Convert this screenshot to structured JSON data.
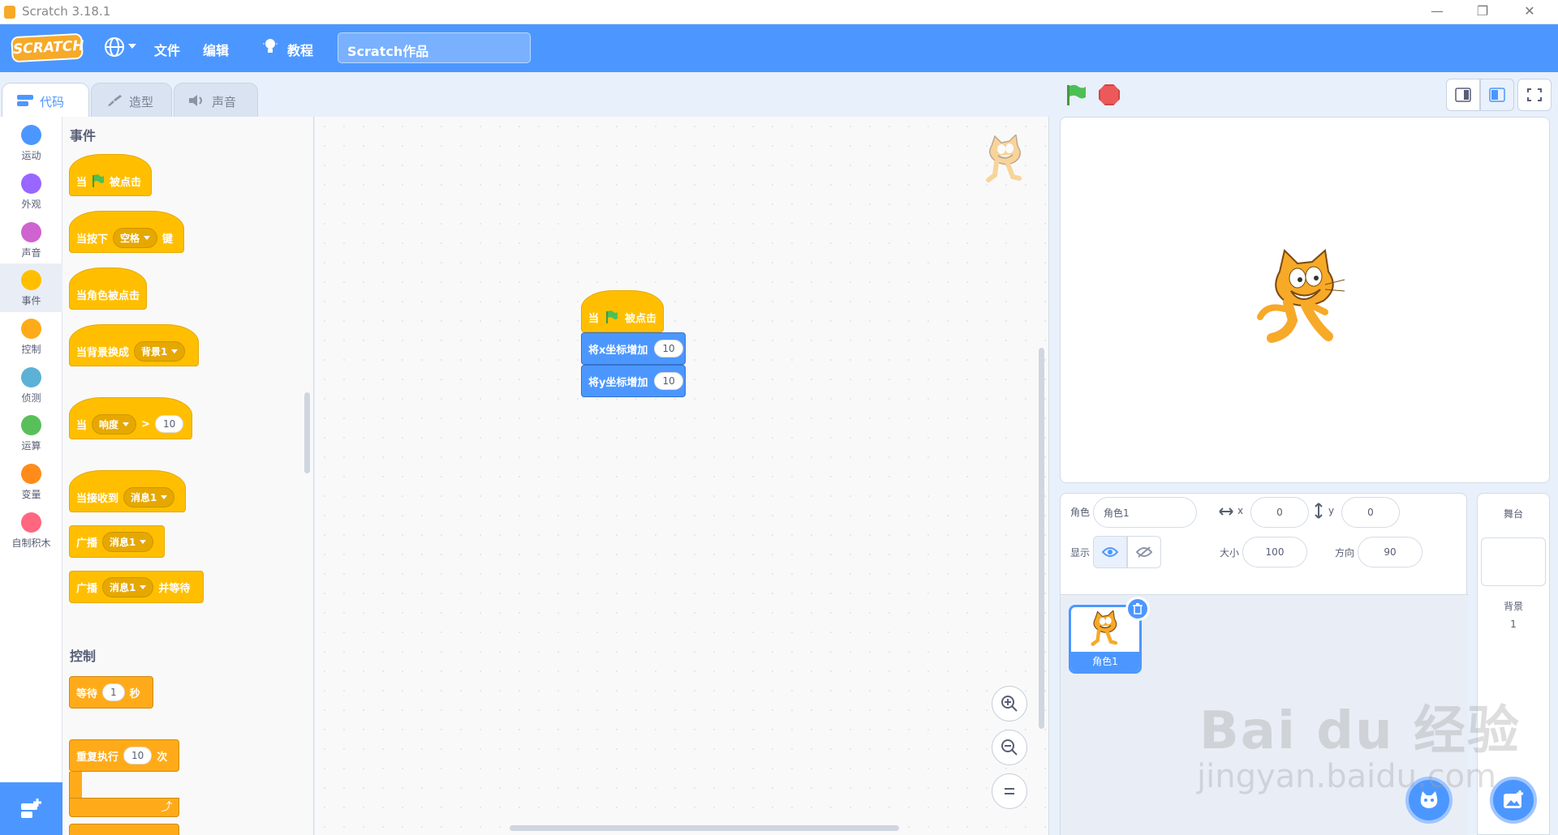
{
  "window": {
    "title": "Scratch 3.18.1"
  },
  "menubar": {
    "logo": "SCRATCH",
    "file": "文件",
    "edit": "编辑",
    "tutorial": "教程",
    "project_title": "Scratch作品"
  },
  "tabs": [
    {
      "label": "代码"
    },
    {
      "label": "造型"
    },
    {
      "label": "声音"
    }
  ],
  "categories": [
    {
      "label": "运动",
      "color": "#4c97ff"
    },
    {
      "label": "外观",
      "color": "#9966ff"
    },
    {
      "label": "声音",
      "color": "#cf63cf"
    },
    {
      "label": "事件",
      "color": "#ffbf00"
    },
    {
      "label": "控制",
      "color": "#ffab19"
    },
    {
      "label": "侦测",
      "color": "#5cb1d6"
    },
    {
      "label": "运算",
      "color": "#59c059"
    },
    {
      "label": "变量",
      "color": "#ff8c1a"
    },
    {
      "label": "自制积木",
      "color": "#ff6680"
    }
  ],
  "palette": {
    "events_title": "事件",
    "b1_when": "当",
    "b1_clicked": "被点击",
    "b2_when": "当按下",
    "b2_dd": "空格",
    "b2_key": "键",
    "b3": "当角色被点击",
    "b4_label": "当背景换成",
    "b4_dd": "背景1",
    "b5_when": "当",
    "b5_dd": "响度",
    "b5_gt": ">",
    "b5_val": "10",
    "b6_label": "当接收到",
    "b6_dd": "消息1",
    "b7_label": "广播",
    "b7_dd": "消息1",
    "b8_label": "广播",
    "b8_dd": "消息1",
    "b8_wait": "并等待",
    "control_title": "控制",
    "c1_label": "等待",
    "c1_val": "1",
    "c1_unit": "秒",
    "c2_label": "重复执行",
    "c2_val": "10",
    "c2_unit": "次"
  },
  "script": {
    "hat_when": "当",
    "hat_clicked": "被点击",
    "s1_label": "将x坐标增加",
    "s1_val": "10",
    "s2_label": "将y坐标增加",
    "s2_val": "10"
  },
  "sprite_info": {
    "sprite_label": "角色",
    "sprite_name": "角色1",
    "x_label": "x",
    "x_val": "0",
    "y_label": "y",
    "y_val": "0",
    "show_label": "显示",
    "size_label": "大小",
    "size_val": "100",
    "dir_label": "方向",
    "dir_val": "90"
  },
  "sprites": [
    {
      "name": "角色1"
    }
  ],
  "stage_panel": {
    "title": "舞台",
    "backdrop_label": "背景",
    "backdrop_count": "1"
  },
  "watermark": {
    "line1": "Bai du 经验",
    "line2": "jingyan.baidu.com"
  }
}
